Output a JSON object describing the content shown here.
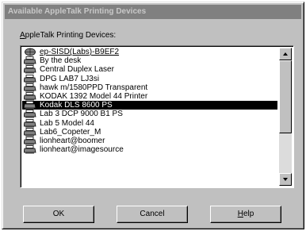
{
  "dialog": {
    "title": "Available AppleTalk Printing Devices",
    "list_label_first": "A",
    "list_label_rest": "ppleTalk Printing Devices:"
  },
  "devices": [
    {
      "label": "ep-SISD(Labs)-B9EF2",
      "icon": "zone-icon",
      "kind": "zone",
      "selected": false
    },
    {
      "label": "By the desk",
      "icon": "printer-icon",
      "kind": "printer",
      "selected": false
    },
    {
      "label": "Central Duplex Laser",
      "icon": "printer-icon",
      "kind": "printer",
      "selected": false
    },
    {
      "label": "DPG LAB7 LJ3si",
      "icon": "printer-icon",
      "kind": "printer",
      "selected": false
    },
    {
      "label": "hawk m/1580PPD Transparent",
      "icon": "printer-icon",
      "kind": "printer",
      "selected": false
    },
    {
      "label": "KODAK 1392 Model 44 Printer",
      "icon": "printer-icon",
      "kind": "printer",
      "selected": false
    },
    {
      "label": "Kodak DLS 8600 PS",
      "icon": "printer-icon",
      "kind": "printer",
      "selected": true
    },
    {
      "label": "Lab 3 DCP 9000 B1 PS",
      "icon": "printer-icon",
      "kind": "printer",
      "selected": false
    },
    {
      "label": "Lab 5 Model 44",
      "icon": "printer-icon",
      "kind": "printer",
      "selected": false
    },
    {
      "label": "Lab6_Copeter_M",
      "icon": "printer-icon",
      "kind": "printer",
      "selected": false
    },
    {
      "label": "lionheart@boomer",
      "icon": "printer-icon",
      "kind": "printer",
      "selected": false
    },
    {
      "label": "lionheart@imagesource",
      "icon": "printer-icon",
      "kind": "printer",
      "selected": false
    }
  ],
  "buttons": {
    "ok": "OK",
    "cancel": "Cancel",
    "help_first": "H",
    "help_rest": "elp"
  },
  "colors": {
    "face": "#c0c0c0",
    "titlebar": "#808080",
    "selection": "#000000"
  }
}
